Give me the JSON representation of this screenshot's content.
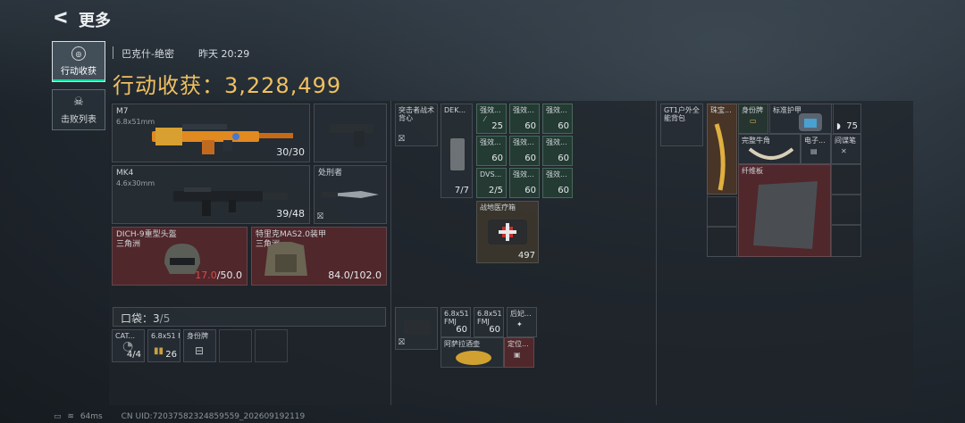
{
  "header": {
    "back_glyph": "ᐸ",
    "title": "更多"
  },
  "sidenav": [
    {
      "label": "行动收获",
      "icon": "target-icon",
      "active": true
    },
    {
      "label": "击败列表",
      "icon": "skull-icon",
      "active": false
    }
  ],
  "match": {
    "map": "巴克什-绝密",
    "time": "昨天 20:29"
  },
  "harvest": {
    "label": "行动收获：3,228,499"
  },
  "loadout": {
    "primary": {
      "name": "M7",
      "ammo_type": "6.8x51mm",
      "ammo": "30/30"
    },
    "secondary": {
      "name": "MK4",
      "ammo_type": "4.6x30mm",
      "ammo": "39/48"
    },
    "melee": {
      "name": "处刑者"
    },
    "helmet": {
      "name": "DICH-9重型头盔",
      "origin": "三角洲",
      "durability_current": "17.0",
      "durability_max": "/50.0"
    },
    "armor": {
      "name": "特里克MAS2.0装甲",
      "origin": "三角洲",
      "durability": "84.0/102.0"
    }
  },
  "pocket": {
    "label": "口袋：",
    "count": "3",
    "capacity": "/5",
    "items": [
      {
        "name": "CAT...",
        "count": "4/4"
      },
      {
        "name": "6.8x51 FMJ",
        "count": "26"
      },
      {
        "name": "身份牌",
        "count": ""
      }
    ]
  },
  "backpack": {
    "rig": {
      "name": "突击者战术背心"
    },
    "items": [
      {
        "name": "DEK...",
        "count": "7/7"
      },
      {
        "name": "强效...",
        "count": "25"
      },
      {
        "name": "强效...",
        "count": "60"
      },
      {
        "name": "强效...",
        "count": "60"
      },
      {
        "name": "强效...",
        "count": "60"
      },
      {
        "name": "强效...",
        "count": "60"
      },
      {
        "name": "强效...",
        "count": "60"
      },
      {
        "name": "DVS...",
        "count": "2/5"
      },
      {
        "name": "强效...",
        "count": "60"
      },
      {
        "name": "强效...",
        "count": "60"
      },
      {
        "name": "战地医疗箱",
        "count": "497"
      }
    ],
    "bottom": [
      {
        "name": "6.8x51 FMJ",
        "count": "60"
      },
      {
        "name": "6.8x51 FMJ",
        "count": "60"
      },
      {
        "name": "后妃...",
        "count": ""
      },
      {
        "name": "阿萨拉酒壶",
        "count": ""
      },
      {
        "name": "定位...",
        "count": ""
      }
    ]
  },
  "case": {
    "rig": {
      "name": "GT1户外全能背包"
    },
    "items": [
      {
        "name": "珠宝...",
        "count": ""
      },
      {
        "name": "身份牌",
        "count": ""
      },
      {
        "name": "标准护甲",
        "count": "75"
      },
      {
        "name": "完整牛角",
        "count": ""
      },
      {
        "name": "电子...",
        "count": ""
      },
      {
        "name": "间谍笔",
        "count": ""
      },
      {
        "name": "纤维板",
        "count": ""
      }
    ]
  },
  "footer": {
    "ping": "64ms",
    "uid": "CN UID:72037582324859559_202609192119"
  },
  "colors": {
    "gold": "#f0c060",
    "accent": "#0fe09a",
    "red_value": "#e04848"
  }
}
